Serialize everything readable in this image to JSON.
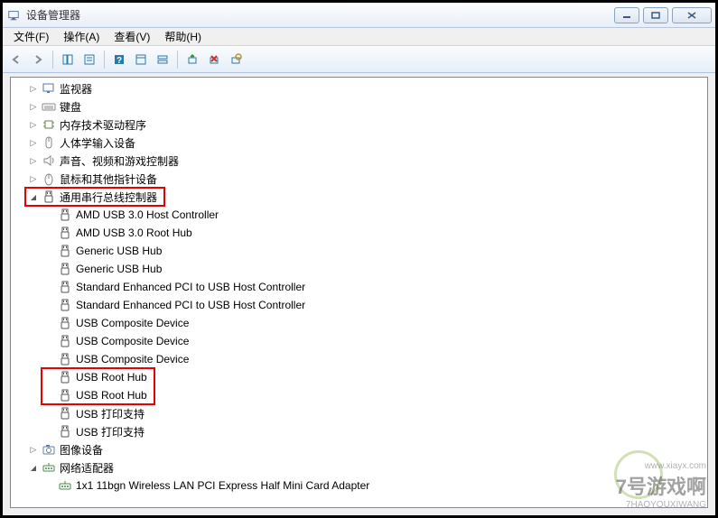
{
  "title": "设备管理器",
  "menus": {
    "file": "文件(F)",
    "action": "操作(A)",
    "view": "查看(V)",
    "help": "帮助(H)"
  },
  "tree": [
    {
      "depth": 1,
      "exp": "collapsed",
      "icon": "monitor",
      "label": "监视器"
    },
    {
      "depth": 1,
      "exp": "collapsed",
      "icon": "keyboard",
      "label": "键盘"
    },
    {
      "depth": 1,
      "exp": "collapsed",
      "icon": "chip",
      "label": "内存技术驱动程序"
    },
    {
      "depth": 1,
      "exp": "collapsed",
      "icon": "hid",
      "label": "人体学输入设备"
    },
    {
      "depth": 1,
      "exp": "collapsed",
      "icon": "sound",
      "label": "声音、视频和游戏控制器"
    },
    {
      "depth": 1,
      "exp": "collapsed",
      "icon": "mouse",
      "label": "鼠标和其他指针设备"
    },
    {
      "depth": 1,
      "exp": "expanded",
      "icon": "usb",
      "label": "通用串行总线控制器",
      "hl": 1
    },
    {
      "depth": 2,
      "exp": "none",
      "icon": "usb",
      "label": "AMD USB 3.0 Host Controller"
    },
    {
      "depth": 2,
      "exp": "none",
      "icon": "usb",
      "label": "AMD USB 3.0 Root Hub"
    },
    {
      "depth": 2,
      "exp": "none",
      "icon": "usb",
      "label": "Generic USB Hub"
    },
    {
      "depth": 2,
      "exp": "none",
      "icon": "usb",
      "label": "Generic USB Hub"
    },
    {
      "depth": 2,
      "exp": "none",
      "icon": "usb",
      "label": "Standard Enhanced PCI to USB Host Controller"
    },
    {
      "depth": 2,
      "exp": "none",
      "icon": "usb",
      "label": "Standard Enhanced PCI to USB Host Controller"
    },
    {
      "depth": 2,
      "exp": "none",
      "icon": "usb",
      "label": "USB Composite Device"
    },
    {
      "depth": 2,
      "exp": "none",
      "icon": "usb",
      "label": "USB Composite Device"
    },
    {
      "depth": 2,
      "exp": "none",
      "icon": "usb",
      "label": "USB Composite Device"
    },
    {
      "depth": 2,
      "exp": "none",
      "icon": "usb",
      "label": "USB Root Hub",
      "hl": 2
    },
    {
      "depth": 2,
      "exp": "none",
      "icon": "usb",
      "label": "USB Root Hub",
      "hl": 2
    },
    {
      "depth": 2,
      "exp": "none",
      "icon": "usb",
      "label": "USB 打印支持"
    },
    {
      "depth": 2,
      "exp": "none",
      "icon": "usb",
      "label": "USB 打印支持"
    },
    {
      "depth": 1,
      "exp": "collapsed",
      "icon": "imaging",
      "label": "图像设备"
    },
    {
      "depth": 1,
      "exp": "expanded",
      "icon": "network",
      "label": "网络适配器"
    },
    {
      "depth": 2,
      "exp": "none",
      "icon": "network",
      "label": "1x1 11bgn Wireless LAN PCI Express Half Mini Card Adapter"
    }
  ],
  "watermark": {
    "main": "7号游戏啊",
    "sub": "7HAOYOUXIWANG",
    "url": "www.xiayx.com"
  }
}
